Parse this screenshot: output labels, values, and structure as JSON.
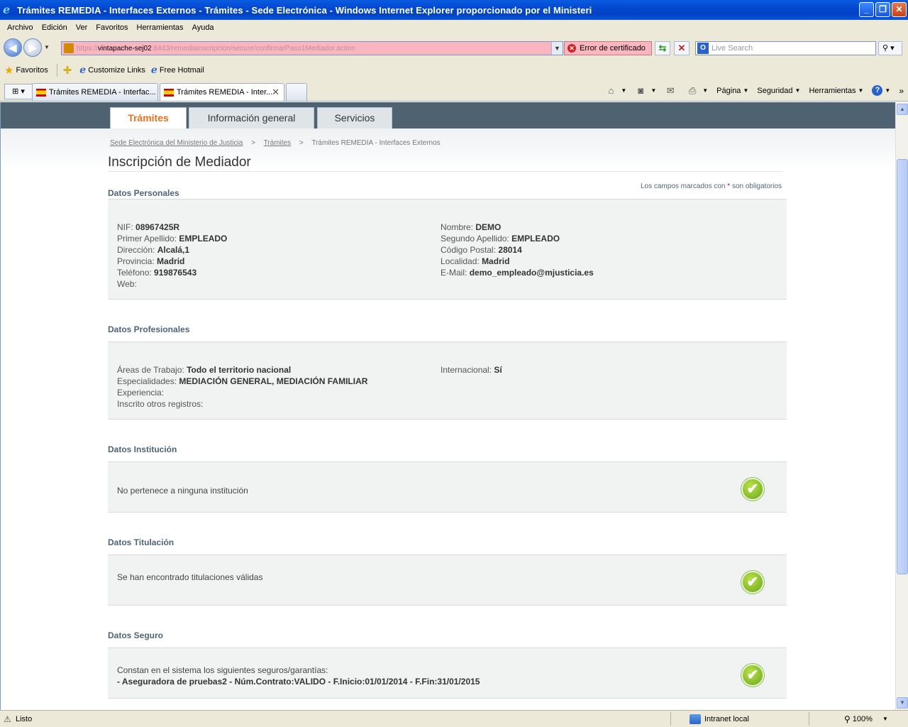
{
  "window": {
    "title": "Trámites REMEDIA - Interfaces Externos - Trámites - Sede Electrónica - Windows Internet Explorer proporcionado por el Ministeri",
    "minimize": "_",
    "maximize": "❐",
    "close": "✕"
  },
  "menu": [
    "Archivo",
    "Edición",
    "Ver",
    "Favoritos",
    "Herramientas",
    "Ayuda"
  ],
  "address": {
    "url_prefix": "https://",
    "url_host": "vintapache-sej02",
    "url_path": ":8443/remediainscripcion/secure/confirmarPaso1Mediador.action",
    "cert_error": "Error de certificado",
    "search_placeholder": "Live Search"
  },
  "favorites": {
    "favoritos": "Favoritos",
    "links": [
      "Customize Links",
      "Free Hotmail"
    ]
  },
  "tabs": [
    {
      "label": "Trámites REMEDIA - Interfac..."
    },
    {
      "label": "Trámites REMEDIA - Inter..."
    }
  ],
  "commands": {
    "pagina": "Página",
    "seguridad": "Seguridad",
    "herramientas": "Herramientas"
  },
  "site_tabs": [
    "Trámites",
    "Información general",
    "Servicios"
  ],
  "breadcrumb": {
    "home": "Sede Electrónica del Ministerio de Justicia",
    "sep": ">",
    "tramites": "Trámites",
    "current": "Trámites REMEDIA - Interfaces Externos"
  },
  "page_title": "Inscripción de Mediador",
  "required_note": {
    "before": "Los campos marcados con",
    "star": "*",
    "after": "son obligatorios"
  },
  "datos_personales": {
    "title": "Datos Personales",
    "left": [
      {
        "label": "NIF:",
        "value": "08967425R"
      },
      {
        "label": "Primer Apellido:",
        "value": "EMPLEADO"
      },
      {
        "label": "Dirección:",
        "value": "Alcalá,1"
      },
      {
        "label": "Provincia:",
        "value": "Madrid"
      },
      {
        "label": "Teléfono:",
        "value": "919876543"
      },
      {
        "label": "Web:",
        "value": ""
      }
    ],
    "right": [
      {
        "label": "Nombre:",
        "value": "DEMO"
      },
      {
        "label": "Segundo Apellido:",
        "value": "EMPLEADO"
      },
      {
        "label": "Código Postal:",
        "value": "28014"
      },
      {
        "label": "Localidad:",
        "value": "Madrid"
      },
      {
        "label": "E-Mail:",
        "value": "demo_empleado@mjusticia.es"
      }
    ]
  },
  "datos_profesionales": {
    "title": "Datos Profesionales",
    "left": [
      {
        "label": "Áreas de Trabajo:",
        "value": "Todo el territorio nacional"
      },
      {
        "label": "Especialidades:",
        "value": "MEDIACIÓN GENERAL, MEDIACIÓN FAMILIAR"
      },
      {
        "label": "Experiencia:",
        "value": ""
      },
      {
        "label": "Inscrito otros registros:",
        "value": ""
      }
    ],
    "right": [
      {
        "label": "Internacional:",
        "value": "Sí"
      }
    ]
  },
  "datos_institucion": {
    "title": "Datos Institución",
    "text": "No pertenece a ninguna institución"
  },
  "datos_titulacion": {
    "title": "Datos Titulación",
    "text": "Se han encontrado titulaciones válidas"
  },
  "datos_seguro": {
    "title": "Datos Seguro",
    "text": "Constan en el sistema los siguientes seguros/garantías:",
    "detail": "- Aseguradora de pruebas2 - Núm.Contrato:VALIDO - F.Inicio:01/01/2014 - F.Fin:31/01/2015"
  },
  "status": {
    "text": "Listo",
    "zone": "Intranet local",
    "zoom": "100%"
  },
  "icons": {
    "check": "✔",
    "star": "★",
    "caret": "▼"
  }
}
